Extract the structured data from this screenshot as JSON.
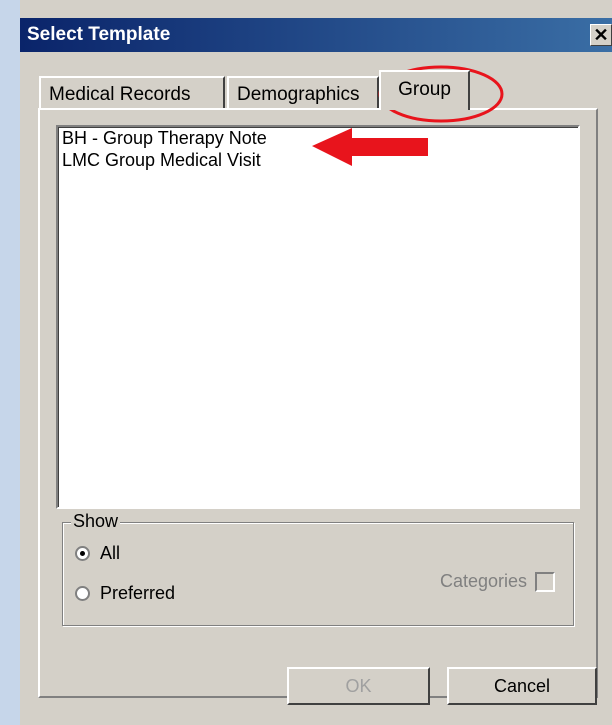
{
  "window": {
    "title": "Select Template"
  },
  "tabs": [
    {
      "label": "Medical Records"
    },
    {
      "label": "Demographics"
    },
    {
      "label": "Group"
    }
  ],
  "list": {
    "items": [
      "BH - Group Therapy Note",
      "LMC Group Medical Visit"
    ]
  },
  "show": {
    "legend": "Show",
    "options": [
      "All",
      "Preferred"
    ],
    "selected": "All",
    "categories_label": "Categories",
    "categories_checked": false
  },
  "buttons": {
    "ok": "OK",
    "cancel": "Cancel"
  },
  "colors": {
    "titlebar": "#0a246a",
    "annotation": "#e8141c"
  },
  "icons": {
    "close": "close-icon"
  }
}
